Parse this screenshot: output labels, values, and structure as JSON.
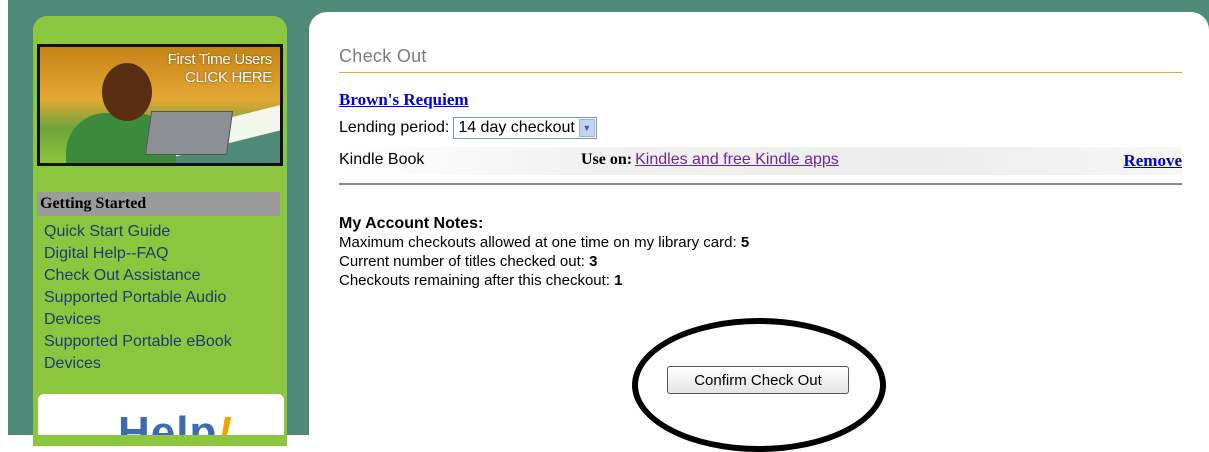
{
  "promo": {
    "line1": "First Time Users",
    "line2": "CLICK HERE"
  },
  "sidebar": {
    "header": "Getting Started",
    "links": [
      "Quick Start Guide",
      "Digital Help--FAQ",
      "Check Out Assistance",
      "Supported Portable Audio Devices",
      "Supported Portable eBook Devices"
    ],
    "help_word": "Help",
    "help_bang": "!"
  },
  "main": {
    "title": "Check Out",
    "book_title": "Brown's Requiem",
    "lending_label": "Lending period:",
    "lending_value": "14 day checkout",
    "format": "Kindle Book",
    "use_on_label": "Use on:",
    "use_on_link": "Kindles and free Kindle apps",
    "remove_label": "Remove"
  },
  "notes": {
    "title": "My Account Notes:",
    "max_label": "Maximum checkouts allowed at one time on my library card:",
    "max_value": "5",
    "current_label": "Current number of titles checked out:",
    "current_value": "3",
    "remaining_label": "Checkouts remaining after this checkout:",
    "remaining_value": "1"
  },
  "confirm_label": "Confirm Check Out",
  "colors": {
    "sidebar": "#8cc63f",
    "frame": "#4f8a78",
    "accent_rule": "#e0a83a",
    "link": "#0000d6"
  }
}
